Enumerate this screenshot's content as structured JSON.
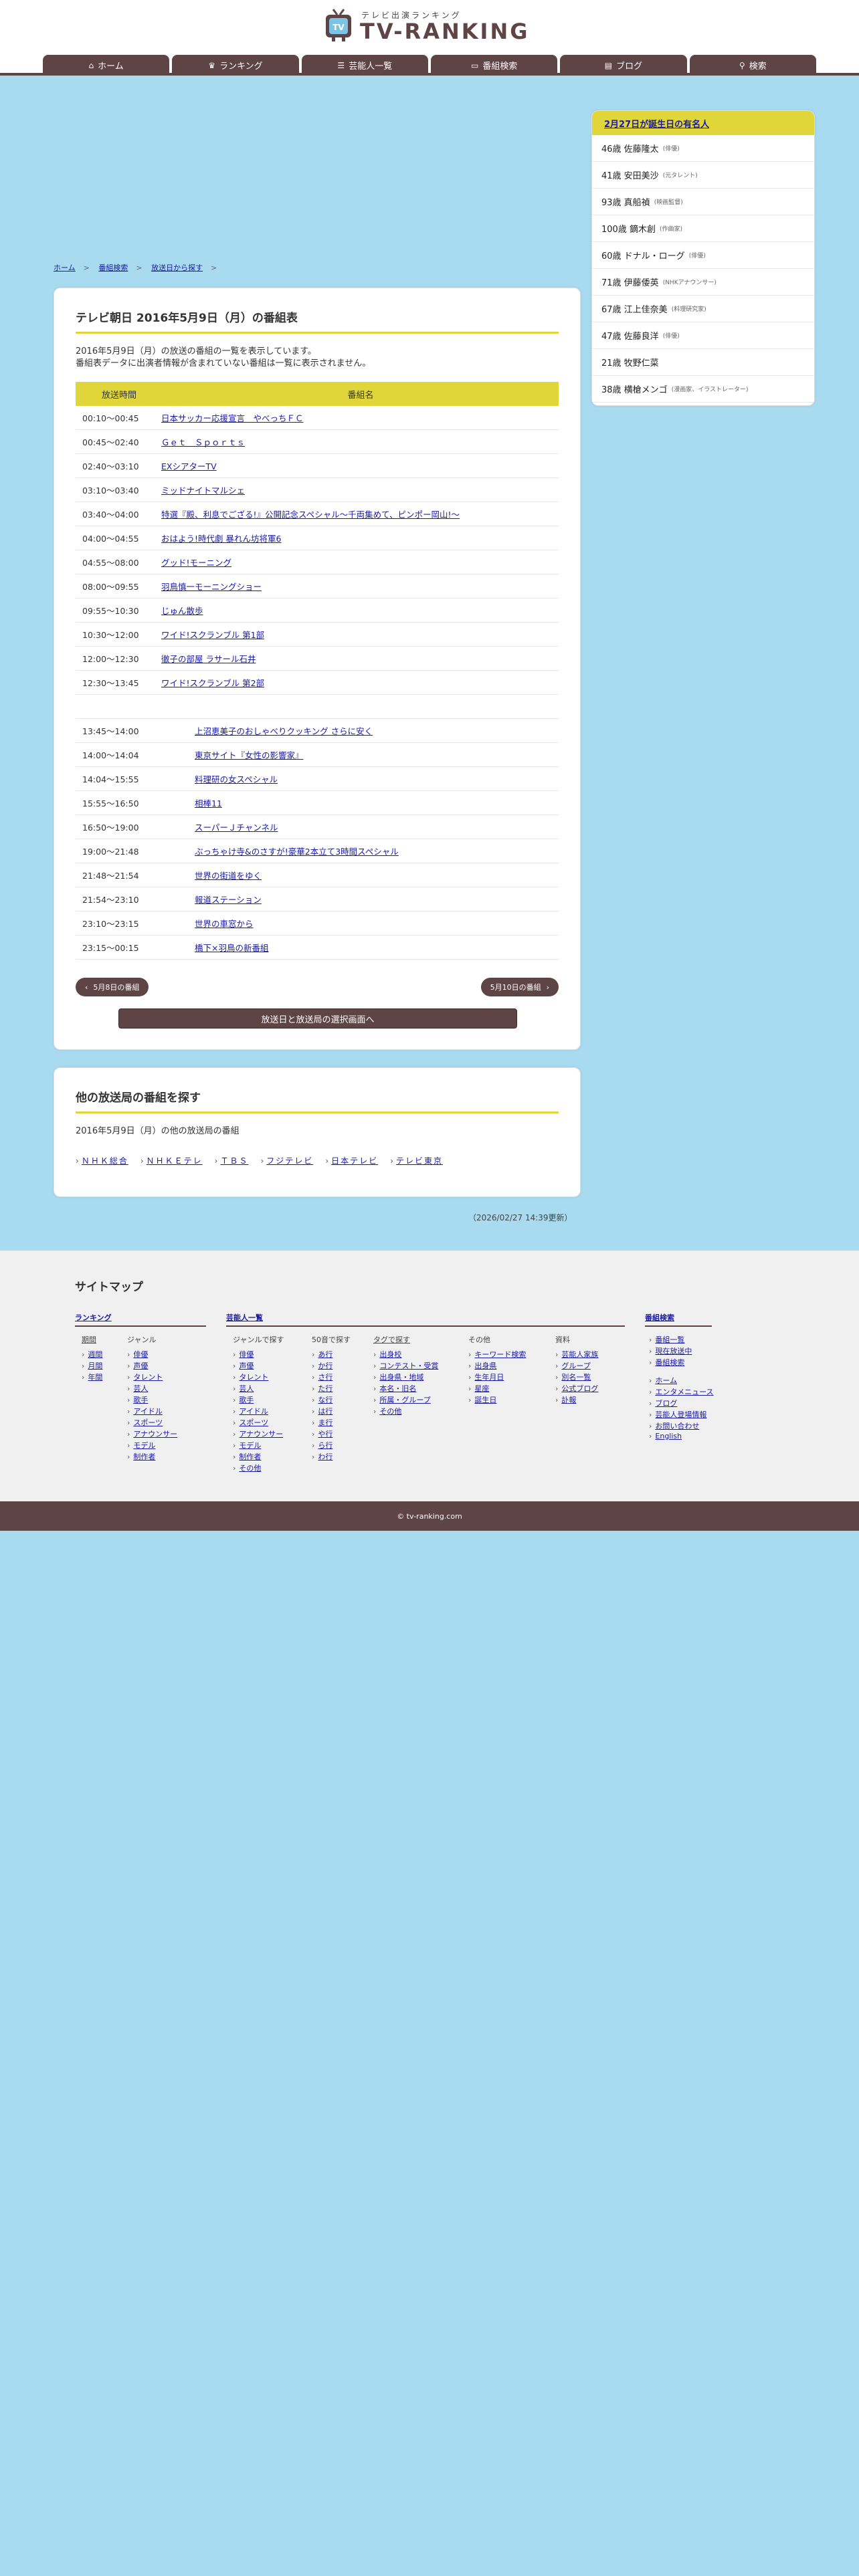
{
  "header": {
    "logo_sub": "テレビ出演ランキング",
    "logo_main": "TV-RANKING",
    "logo_badge": "TV"
  },
  "nav": [
    {
      "label": "ホーム",
      "icon": "home-icon",
      "glyph": "⌂"
    },
    {
      "label": "ランキング",
      "icon": "crown-icon",
      "glyph": "♛"
    },
    {
      "label": "芸能人一覧",
      "icon": "list-icon",
      "glyph": "☰"
    },
    {
      "label": "番組検索",
      "icon": "tv-icon",
      "glyph": "▭"
    },
    {
      "label": "ブログ",
      "icon": "blog-icon",
      "glyph": "▤"
    },
    {
      "label": "検索",
      "icon": "search-icon",
      "glyph": "⚲"
    }
  ],
  "breadcrumb": [
    "ホーム",
    "番組検索",
    "放送日から探す"
  ],
  "schedule": {
    "title": "テレビ朝日 2016年5月9日（月）の番組表",
    "desc1": "2016年5月9日（月）の放送の番組の一覧を表示しています。",
    "desc2": "番組表データに出演者情報が含まれていない番組は一覧に表示されません。",
    "col_time": "放送時間",
    "col_program": "番組名",
    "rows_a": [
      {
        "time": "00:10〜00:45",
        "program": "日本サッカー応援宣言　やべっちＦＣ"
      },
      {
        "time": "00:45〜02:40",
        "program": "Ｇｅｔ　Ｓｐｏｒｔｓ"
      },
      {
        "time": "02:40〜03:10",
        "program": "EXシアターTV"
      },
      {
        "time": "03:10〜03:40",
        "program": "ミッドナイトマルシェ"
      },
      {
        "time": "03:40〜04:00",
        "program": "特選『殿、利息でござる!』公開記念スペシャル〜千両集めて、ピンポー岡山!〜"
      },
      {
        "time": "04:00〜04:55",
        "program": "おはよう!時代劇 暴れん坊将軍6"
      },
      {
        "time": "04:55〜08:00",
        "program": "グッド!モーニング"
      },
      {
        "time": "08:00〜09:55",
        "program": "羽鳥慎一モーニングショー"
      },
      {
        "time": "09:55〜10:30",
        "program": "じゅん散歩"
      },
      {
        "time": "10:30〜12:00",
        "program": "ワイド!スクランブル 第1部"
      },
      {
        "time": "12:00〜12:30",
        "program": "徹子の部屋 ラサール石井"
      },
      {
        "time": "12:30〜13:45",
        "program": "ワイド!スクランブル 第2部"
      }
    ],
    "rows_b": [
      {
        "time": "13:45〜14:00",
        "program": "上沼恵美子のおしゃべりクッキング さらに安く"
      },
      {
        "time": "14:00〜14:04",
        "program": "東京サイト『女性の影響家』"
      },
      {
        "time": "14:04〜15:55",
        "program": "料理研の女スペシャル"
      },
      {
        "time": "15:55〜16:50",
        "program": "相棒11"
      },
      {
        "time": "16:50〜19:00",
        "program": "スーパーＪチャンネル"
      },
      {
        "time": "19:00〜21:48",
        "program": "ぶっちゃけ寺&のさすが!豪華2本立て3時間スペシャル"
      },
      {
        "time": "21:48〜21:54",
        "program": "世界の街道をゆく"
      },
      {
        "time": "21:54〜23:10",
        "program": "報道ステーション"
      },
      {
        "time": "23:10〜23:15",
        "program": "世界の車窓から"
      },
      {
        "time": "23:15〜00:15",
        "program": "橋下×羽鳥の新番組"
      }
    ],
    "prev": "5月8日の番組",
    "next": "5月10日の番組",
    "select": "放送日と放送局の選択画面へ"
  },
  "other": {
    "title": "他の放送局の番組を探す",
    "desc": "2016年5月9日（月）の他の放送局の番組",
    "stations": [
      "ＮＨＫ総合",
      "ＮＨＫＥテレ",
      "ＴＢＳ",
      "フジテレビ",
      "日本テレビ",
      "テレビ東京"
    ]
  },
  "updated": "（2026/02/27 14:39更新）",
  "sidebar": {
    "title": "2月27日が誕生日の有名人",
    "items": [
      {
        "name": "46歳 佐藤隆太",
        "job": "(俳優)"
      },
      {
        "name": "41歳 安田美沙",
        "job": "(元タレント)"
      },
      {
        "name": "93歳 真船禎",
        "job": "(映画監督)"
      },
      {
        "name": "100歳 鏑木創",
        "job": "(作曲家)"
      },
      {
        "name": "60歳 ドナル・ローグ",
        "job": "(俳優)"
      },
      {
        "name": "71歳 伊藤倭英",
        "job": "(NHKアナウンサー)"
      },
      {
        "name": "67歳 江上佳奈美",
        "job": "(料理研究家)"
      },
      {
        "name": "47歳 佐藤良洋",
        "job": "(俳優)"
      },
      {
        "name": "21歳 牧野仁菜",
        "job": ""
      },
      {
        "name": "38歳 横槍メンゴ",
        "job": "(漫画家、イラストレーター)"
      }
    ]
  },
  "sitemap": {
    "title": "サイトマップ",
    "ranking": {
      "head": "ランキング",
      "periods": [
        "期間",
        "週間",
        "月間",
        "年間"
      ],
      "genre_label": "ジャンル",
      "genres": [
        "俳優",
        "声優",
        "タレント",
        "芸人",
        "歌手",
        "アイドル",
        "スポーツ",
        "アナウンサー",
        "モデル",
        "制作者"
      ]
    },
    "people": {
      "head": "芸能人一覧",
      "genre_label": "ジャンルで探す",
      "genres": [
        "俳優",
        "声優",
        "タレント",
        "芸人",
        "歌手",
        "アイドル",
        "スポーツ",
        "アナウンサー",
        "モデル",
        "制作者",
        "その他"
      ],
      "kana_label": "50音で探す",
      "kana": [
        "あ行",
        "か行",
        "さ行",
        "た行",
        "な行",
        "は行",
        "ま行",
        "や行",
        "ら行",
        "わ行"
      ],
      "tag_label": "タグで探す",
      "tags": [
        "出身校",
        "コンテスト・受賞",
        "出身県・地域",
        "本名・旧名",
        "所属・グループ",
        "その他"
      ],
      "other_label": "その他",
      "others": [
        "キーワード検索",
        "出身県",
        "生年月日",
        "星座",
        "誕生日"
      ],
      "data_label": "資料",
      "data": [
        "芸能人家族",
        "グループ",
        "別名一覧",
        "公式ブログ",
        "訃報"
      ]
    },
    "program": {
      "head": "番組検索",
      "items": [
        "番組一覧",
        "現在放送中",
        "番組検索"
      ],
      "items2": [
        "ホーム",
        "エンタメニュース",
        "ブログ",
        "芸能人登場情報",
        "お問い合わせ",
        "English"
      ]
    }
  },
  "footer": "© tv-ranking.com"
}
